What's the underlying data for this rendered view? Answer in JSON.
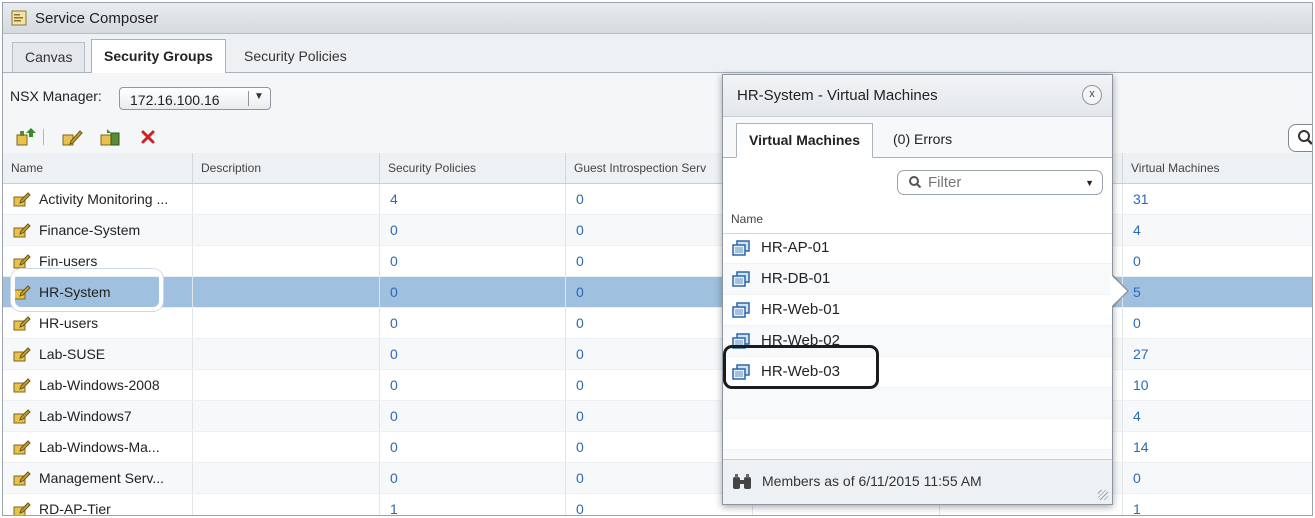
{
  "window": {
    "title": "Service Composer"
  },
  "tabs": [
    {
      "label": "Canvas",
      "active": false
    },
    {
      "label": "Security Groups",
      "active": true
    },
    {
      "label": "Security Policies",
      "active": false
    }
  ],
  "nsx": {
    "label": "NSX Manager:",
    "value": "172.16.100.16"
  },
  "grid": {
    "columns": [
      "Name",
      "Description",
      "Security Policies",
      "Guest Introspection Serv",
      "",
      "",
      "Virtual Machines"
    ],
    "rows": [
      {
        "name": "Activity Monitoring ...",
        "policies": "4",
        "guest": "0",
        "vms": "31"
      },
      {
        "name": "Finance-System",
        "policies": "0",
        "guest": "0",
        "vms": "4"
      },
      {
        "name": "Fin-users",
        "policies": "0",
        "guest": "0",
        "vms": "0"
      },
      {
        "name": "HR-System",
        "policies": "0",
        "guest": "0",
        "vms": "5"
      },
      {
        "name": "HR-users",
        "policies": "0",
        "guest": "0",
        "vms": "0"
      },
      {
        "name": "Lab-SUSE",
        "policies": "0",
        "guest": "0",
        "vms": "27"
      },
      {
        "name": "Lab-Windows-2008",
        "policies": "0",
        "guest": "0",
        "vms": "10"
      },
      {
        "name": "Lab-Windows7",
        "policies": "0",
        "guest": "0",
        "vms": "4"
      },
      {
        "name": "Lab-Windows-Ma...",
        "policies": "0",
        "guest": "0",
        "vms": "14"
      },
      {
        "name": "Management Serv...",
        "policies": "0",
        "guest": "0",
        "vms": "0"
      },
      {
        "name": "RD-AP-Tier",
        "policies": "1",
        "guest": "0",
        "vms": "1"
      }
    ]
  },
  "popup": {
    "title": "HR-System - Virtual Machines",
    "close_label": "x",
    "tabs": [
      {
        "label": "Virtual Machines",
        "active": true
      },
      {
        "label": "(0) Errors",
        "active": false
      }
    ],
    "filter_placeholder": "Filter",
    "column": "Name",
    "vms": [
      "HR-AP-01",
      "HR-DB-01",
      "HR-Web-01",
      "HR-Web-02",
      "HR-Web-03"
    ],
    "footer": "Members as of 6/11/2015 11:55 AM"
  },
  "colors": {
    "selected_row": "#9fc0de",
    "link_number": "#2a6bb3",
    "delete_icon": "#cc2222"
  }
}
